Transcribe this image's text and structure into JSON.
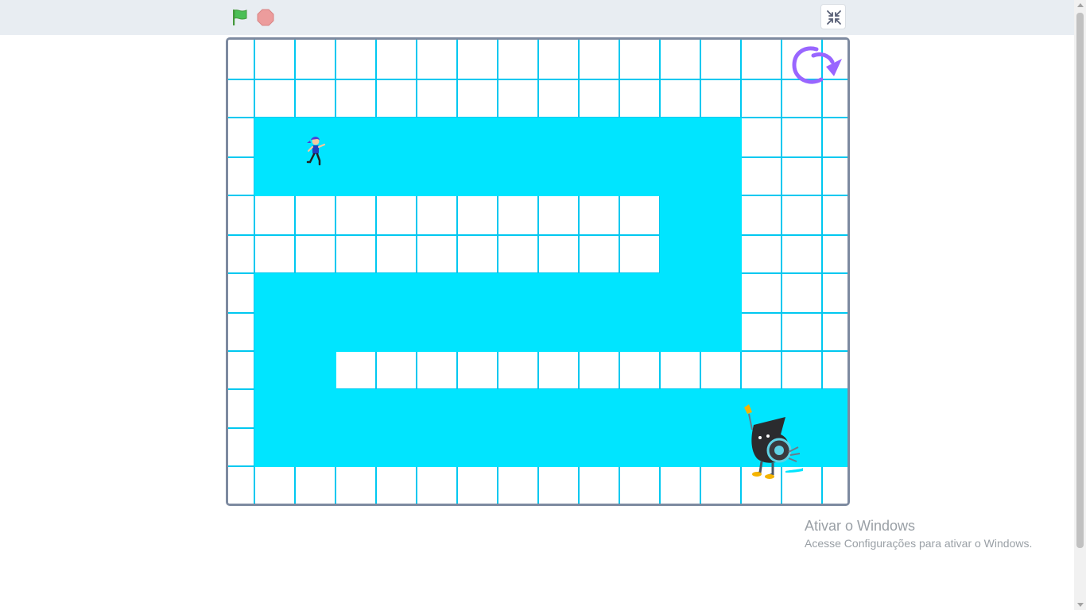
{
  "toolbar": {
    "green_flag_icon": "green-flag-icon",
    "stop_icon": "stop-sign-icon",
    "fullscreen_icon": "exit-fullscreen-icon"
  },
  "stage": {
    "grid": {
      "columns": 16,
      "rows": 12,
      "line_color": "#00c8f0",
      "background": "#ffffff"
    },
    "path_color": "#00e5ff",
    "path_rows": [
      {
        "row": 2,
        "col_start": 1,
        "col_end": 12
      },
      {
        "row": 3,
        "col_start": 1,
        "col_end": 12
      },
      {
        "row": 4,
        "col_start": 11,
        "col_end": 12
      },
      {
        "row": 5,
        "col_start": 11,
        "col_end": 12
      },
      {
        "row": 6,
        "col_start": 1,
        "col_end": 12
      },
      {
        "row": 7,
        "col_start": 1,
        "col_end": 12
      },
      {
        "row": 8,
        "col_start": 1,
        "col_end": 2
      },
      {
        "row": 9,
        "col_start": 1,
        "col_end": 15
      },
      {
        "row": 10,
        "col_start": 1,
        "col_end": 15
      }
    ],
    "sprites": {
      "player": "runner-girl-icon",
      "goal": "whistle-character-icon",
      "restart": "restart-arrow-icon"
    }
  },
  "colors": {
    "accent_purple": "#9966ff",
    "flag_green": "#4cbf56",
    "stop_red": "#ec9c9c"
  },
  "watermark": {
    "title": "Ativar o Windows",
    "subtitle": "Acesse Configurações para ativar o Windows."
  }
}
